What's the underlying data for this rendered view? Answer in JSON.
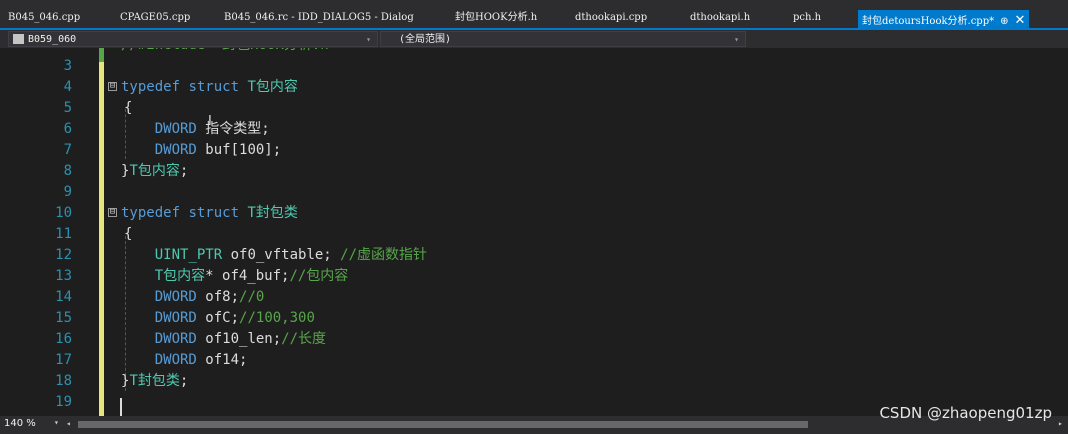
{
  "tabs": [
    {
      "label": "B045_046.cpp"
    },
    {
      "label": "CPAGE05.cpp"
    },
    {
      "label": "B045_046.rc - IDD_DIALOG5 - Dialog"
    },
    {
      "label": "封包HOOK分析.h"
    },
    {
      "label": "dthookapi.cpp"
    },
    {
      "label": "dthookapi.h"
    },
    {
      "label": "pch.h"
    },
    {
      "label": "封包detoursHook分析.cpp*",
      "pin": "⊕",
      "close": "✕"
    }
  ],
  "nav": {
    "scope_combo": "B059_060",
    "member_combo": "(全局范围)",
    "dropdown_arrow": "▾"
  },
  "editor": {
    "partial_top_line": "//#include \"封包HOOK分析.h\"",
    "lines": [
      {
        "n": "3"
      },
      {
        "n": "4",
        "fold": "⊟",
        "parts": [
          {
            "c": "kw",
            "t": "typedef"
          },
          {
            "c": "plain",
            "t": " "
          },
          {
            "c": "kw",
            "t": "struct"
          },
          {
            "c": "plain",
            "t": " "
          },
          {
            "c": "type",
            "t": "T包内容"
          }
        ]
      },
      {
        "n": "5",
        "parts": [
          {
            "c": "plain",
            "t": "{"
          }
        ]
      },
      {
        "n": "6",
        "parts": [
          {
            "c": "plain",
            "t": "    "
          },
          {
            "c": "kw",
            "t": "DWORD"
          },
          {
            "c": "plain",
            "t": " 指令类型;"
          }
        ]
      },
      {
        "n": "7",
        "parts": [
          {
            "c": "plain",
            "t": "    "
          },
          {
            "c": "kw",
            "t": "DWORD"
          },
          {
            "c": "plain",
            "t": " buf[100];"
          }
        ]
      },
      {
        "n": "8",
        "parts": [
          {
            "c": "plain",
            "t": "}"
          },
          {
            "c": "type",
            "t": "T包内容"
          },
          {
            "c": "plain",
            "t": ";"
          }
        ]
      },
      {
        "n": "9"
      },
      {
        "n": "10",
        "fold": "⊟",
        "parts": [
          {
            "c": "kw",
            "t": "typedef"
          },
          {
            "c": "plain",
            "t": " "
          },
          {
            "c": "kw",
            "t": "struct"
          },
          {
            "c": "plain",
            "t": " "
          },
          {
            "c": "type",
            "t": "T封包类"
          }
        ]
      },
      {
        "n": "11",
        "parts": [
          {
            "c": "plain",
            "t": "{"
          }
        ]
      },
      {
        "n": "12",
        "parts": [
          {
            "c": "plain",
            "t": "    "
          },
          {
            "c": "type",
            "t": "UINT_PTR"
          },
          {
            "c": "plain",
            "t": " of0_vftable; "
          },
          {
            "c": "cm",
            "t": "//虚函数指针"
          }
        ]
      },
      {
        "n": "13",
        "parts": [
          {
            "c": "plain",
            "t": "    "
          },
          {
            "c": "type",
            "t": "T包内容"
          },
          {
            "c": "plain",
            "t": "* of4_buf;"
          },
          {
            "c": "cm",
            "t": "//包内容"
          }
        ]
      },
      {
        "n": "14",
        "parts": [
          {
            "c": "plain",
            "t": "    "
          },
          {
            "c": "kw",
            "t": "DWORD"
          },
          {
            "c": "plain",
            "t": " of8;"
          },
          {
            "c": "cm",
            "t": "//0"
          }
        ]
      },
      {
        "n": "15",
        "parts": [
          {
            "c": "plain",
            "t": "    "
          },
          {
            "c": "kw",
            "t": "DWORD"
          },
          {
            "c": "plain",
            "t": " ofC;"
          },
          {
            "c": "cm",
            "t": "//100,300"
          }
        ]
      },
      {
        "n": "16",
        "parts": [
          {
            "c": "plain",
            "t": "    "
          },
          {
            "c": "kw",
            "t": "DWORD"
          },
          {
            "c": "plain",
            "t": " of10_len;"
          },
          {
            "c": "cm",
            "t": "//长度"
          }
        ]
      },
      {
        "n": "17",
        "parts": [
          {
            "c": "plain",
            "t": "    "
          },
          {
            "c": "kw",
            "t": "DWORD"
          },
          {
            "c": "plain",
            "t": " of14;"
          }
        ]
      },
      {
        "n": "18",
        "parts": [
          {
            "c": "plain",
            "t": "}"
          },
          {
            "c": "type",
            "t": "T封包类"
          },
          {
            "c": "plain",
            "t": ";"
          }
        ]
      },
      {
        "n": "19"
      }
    ]
  },
  "status": {
    "zoom": "140 %",
    "zoom_arrow": "▾",
    "scroll_left": "◂",
    "scroll_right": "▸"
  },
  "watermark": "CSDN @zhaopeng01zp",
  "colors": {
    "background": "#1e1e1e",
    "accent": "#007acc",
    "keyword": "#569cd6",
    "type": "#4ec9b0",
    "comment": "#57a64a",
    "line_number": "#2b91af",
    "changed_margin": "#e8e57a"
  }
}
